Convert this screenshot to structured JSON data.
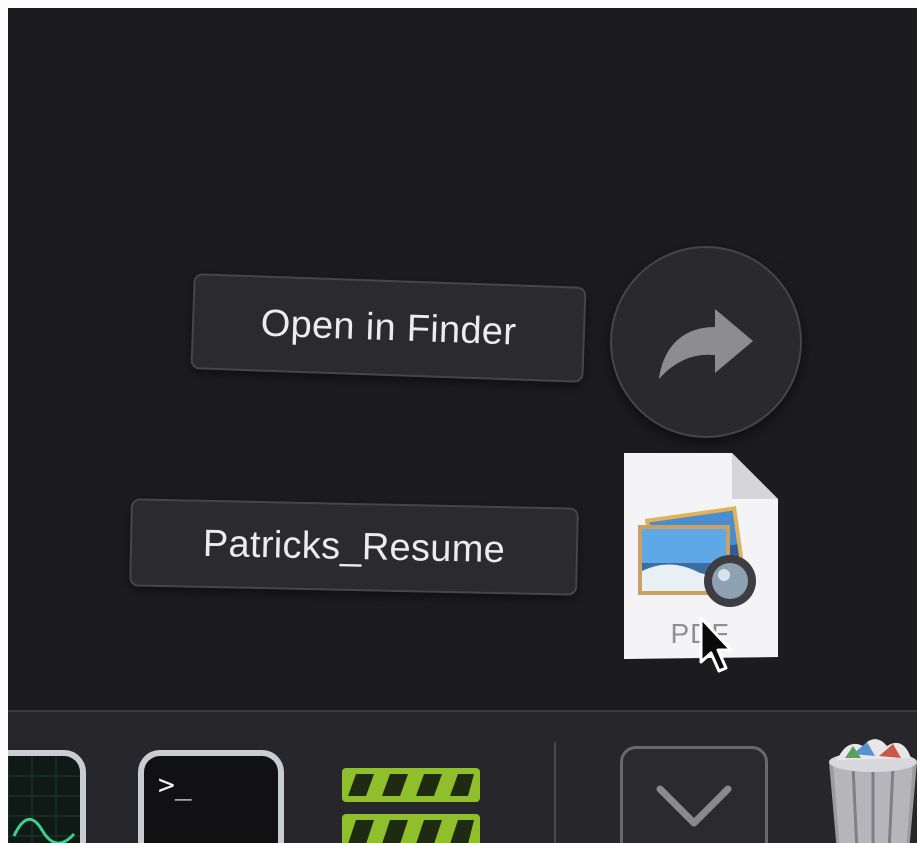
{
  "share_menu": {
    "action_label": "Open in Finder",
    "file_name": "Patricks_Resume",
    "file_type_label": "PDF"
  },
  "dock": {
    "terminal_prompt": ">_",
    "items": [
      "activity-monitor",
      "terminal",
      "motion",
      "downloads",
      "trash"
    ]
  },
  "icons": {
    "share": "share-arrow-icon",
    "file": "pdf-document-icon",
    "cursor": "pointer-cursor-icon",
    "downloads": "chevron-down-icon"
  },
  "colors": {
    "background": "#1c1b1f",
    "pill": "#2b2a2f",
    "dock": "#27262b",
    "motion_green": "#8fbf2a"
  }
}
